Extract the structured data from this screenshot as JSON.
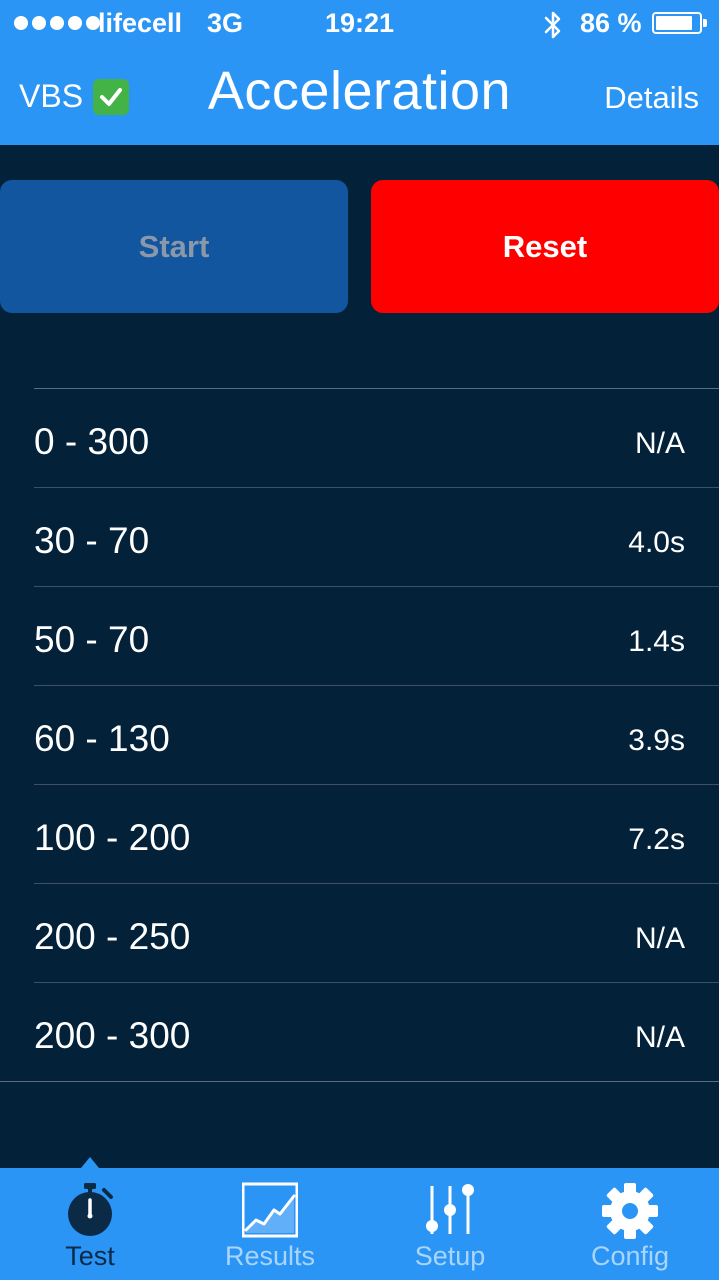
{
  "status_bar": {
    "carrier": "lifecell",
    "network": "3G",
    "time": "19:21",
    "battery_percent": "86 %",
    "battery_level": 0.86
  },
  "nav": {
    "left_label": "VBS",
    "title": "Acceleration",
    "right_label": "Details"
  },
  "buttons": {
    "start_label": "Start",
    "reset_label": "Reset"
  },
  "results": [
    {
      "range": "0 - 300",
      "value": "N/A"
    },
    {
      "range": "30 - 70",
      "value": "4.0s"
    },
    {
      "range": "50 - 70",
      "value": "1.4s"
    },
    {
      "range": "60 - 130",
      "value": "3.9s"
    },
    {
      "range": "100 - 200",
      "value": "7.2s"
    },
    {
      "range": "200 - 250",
      "value": "N/A"
    },
    {
      "range": "200 - 300",
      "value": "N/A"
    }
  ],
  "tabs": [
    {
      "label": "Test",
      "icon": "stopwatch-icon",
      "active": true
    },
    {
      "label": "Results",
      "icon": "chart-icon",
      "active": false
    },
    {
      "label": "Setup",
      "icon": "sliders-icon",
      "active": false
    },
    {
      "label": "Config",
      "icon": "gear-icon",
      "active": false
    }
  ],
  "colors": {
    "accent": "#2b95f6",
    "background": "#032138",
    "start_button": "#1256a0",
    "reset_button": "#fe0000"
  }
}
